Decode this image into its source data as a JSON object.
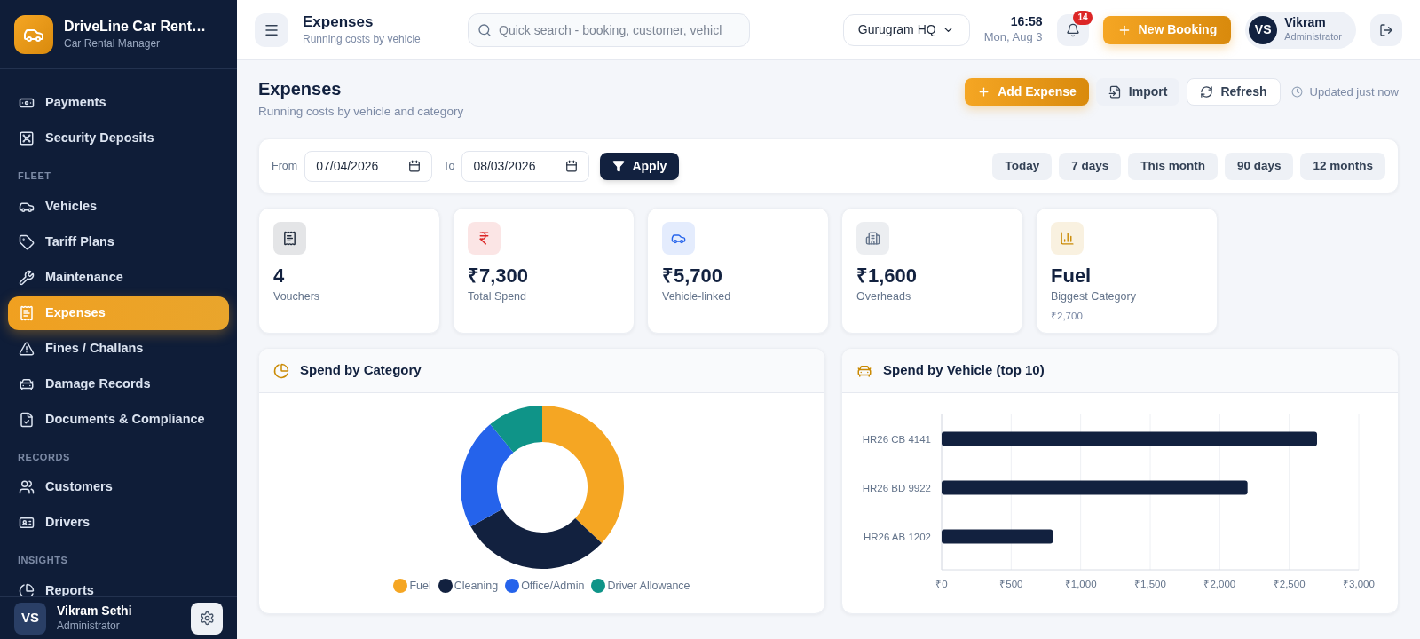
{
  "brand": {
    "title": "DriveLine Car Rent…",
    "subtitle": "Car Rental Manager"
  },
  "sidebar": {
    "sections": [
      {
        "items": [
          {
            "label": "Payments",
            "selected": false
          },
          {
            "label": "Security Deposits",
            "selected": false
          }
        ]
      },
      {
        "heading": "FLEET",
        "items": [
          {
            "label": "Vehicles",
            "selected": false
          },
          {
            "label": "Tariff Plans",
            "selected": false
          },
          {
            "label": "Maintenance",
            "selected": false
          },
          {
            "label": "Expenses",
            "selected": true
          },
          {
            "label": "Fines / Challans",
            "selected": false
          },
          {
            "label": "Damage Records",
            "selected": false
          },
          {
            "label": "Documents & Compliance",
            "selected": false
          }
        ]
      },
      {
        "heading": "RECORDS",
        "items": [
          {
            "label": "Customers",
            "selected": false
          },
          {
            "label": "Drivers",
            "selected": false
          }
        ]
      },
      {
        "heading": "INSIGHTS",
        "items": [
          {
            "label": "Reports",
            "selected": false
          }
        ]
      }
    ],
    "user": {
      "initials": "VS",
      "name": "Vikram Sethi",
      "role": "Administrator"
    }
  },
  "topbar": {
    "title": "Expenses",
    "subtitle": "Running costs by vehicle",
    "search_placeholder": "Quick search - booking, customer, vehicl",
    "branch": "Gurugram HQ",
    "time": "16:58",
    "date": "Mon, Aug 3",
    "notifications": "14",
    "new_booking": "New Booking",
    "user": {
      "initials": "VS",
      "name": "Vikram",
      "role": "Administrator"
    }
  },
  "page": {
    "title": "Expenses",
    "subtitle": "Running costs by vehicle and category",
    "actions": [
      "Add Expense",
      "Import",
      "Refresh"
    ],
    "updated": "Updated just now"
  },
  "filters": {
    "from_label": "From",
    "from": "07/04/2026",
    "to_label": "To",
    "to": "08/03/2026",
    "apply": "Apply",
    "presets": [
      "Today",
      "7 days",
      "This month",
      "90 days",
      "12 months"
    ]
  },
  "stats": [
    {
      "value": "4",
      "label": "Vouchers",
      "color": "#1e293b"
    },
    {
      "value": "₹7,300",
      "label": "Total Spend",
      "color": "#dc2626"
    },
    {
      "value": "₹5,700",
      "label": "Vehicle-linked",
      "color": "#2563eb"
    },
    {
      "value": "₹1,600",
      "label": "Overheads",
      "color": "#64748b"
    },
    {
      "value": "Fuel",
      "label": "Biggest Category",
      "note": "₹2,700",
      "color": "#ca8a04"
    }
  ],
  "category_panel": {
    "title": "Spend by Category",
    "chart_data": {
      "type": "donut",
      "categories": [
        "Fuel",
        "Cleaning",
        "Office/Admin",
        "Driver Allowance"
      ],
      "series": [
        {
          "values": [
            37,
            30,
            22,
            11
          ]
        }
      ],
      "colors": [
        "#f5a623",
        "#12213f",
        "#2563eb",
        "#0f9488"
      ]
    }
  },
  "vehicle_panel": {
    "title": "Spend by Vehicle (top 10)",
    "chart_data": {
      "type": "bar",
      "orientation": "horizontal",
      "categories": [
        "HR26 CB 4141",
        "HR26 BD 9922",
        "HR26 AB 1202"
      ],
      "series": [
        {
          "color": "#12213f",
          "values": [
            2700,
            2200,
            800
          ]
        }
      ],
      "xlim": [
        0,
        3000
      ],
      "grid": true,
      "xticks": [
        {
          "value": 0,
          "label": "₹0"
        },
        {
          "value": 500,
          "label": "₹500"
        },
        {
          "value": 1000,
          "label": "₹1,000"
        },
        {
          "value": 1500,
          "label": "₹1,500"
        },
        {
          "value": 2000,
          "label": "₹2,000"
        },
        {
          "value": 2500,
          "label": "₹2,500"
        },
        {
          "value": 3000,
          "label": "₹3,000"
        }
      ]
    }
  }
}
